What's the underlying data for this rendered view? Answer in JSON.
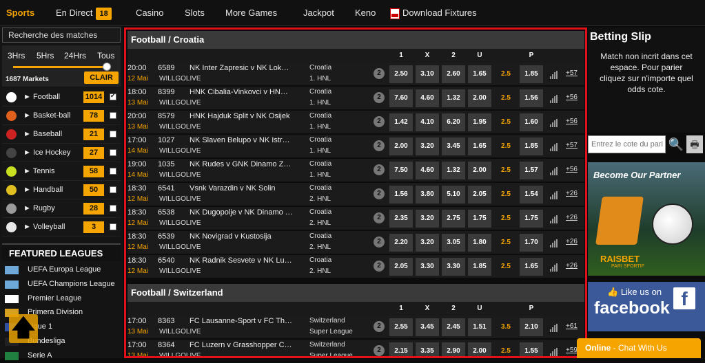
{
  "nav": {
    "sports": "Sports",
    "en_direct": "En Direct",
    "live_count": "18",
    "casino": "Casino",
    "slots": "Slots",
    "more_games": "More Games",
    "jackpot": "Jackpot",
    "keno": "Keno",
    "download": "Download Fixtures"
  },
  "sidebar": {
    "search": "Recherche des matches",
    "timeframes": [
      "3Hrs",
      "5Hrs",
      "24Hrs",
      "Tous"
    ],
    "markets": "1687 Markets",
    "clear": "CLAIR",
    "sports": [
      {
        "name": "► Football",
        "count": "1014",
        "checked": true,
        "color": "#ffffff"
      },
      {
        "name": "► Basket-ball",
        "count": "78",
        "checked": false,
        "color": "#e0601c"
      },
      {
        "name": "► Baseball",
        "count": "21",
        "checked": false,
        "color": "#cc2222"
      },
      {
        "name": "► Ice Hockey",
        "count": "27",
        "checked": false,
        "color": "#444444"
      },
      {
        "name": "► Tennis",
        "count": "58",
        "checked": false,
        "color": "#c8e020"
      },
      {
        "name": "► Handball",
        "count": "50",
        "checked": false,
        "color": "#e0c020"
      },
      {
        "name": "► Rugby",
        "count": "28",
        "checked": false,
        "color": "#9a9a9a"
      },
      {
        "name": "► Volleyball",
        "count": "3",
        "checked": false,
        "color": "#e8e8e8"
      }
    ],
    "featured_title": "FEATURED LEAGUES",
    "leagues": [
      {
        "name": "UEFA Europa League",
        "flag": "#6ea8d8"
      },
      {
        "name": "UEFA Champions League",
        "flag": "#6ea8d8"
      },
      {
        "name": "Premier League",
        "flag": "#ffffff"
      },
      {
        "name": "Primera Division",
        "flag": "#d8a020"
      },
      {
        "name": "Ligue 1",
        "flag": "#3050a0"
      },
      {
        "name": "Bundesliga",
        "flag": "#222222"
      },
      {
        "name": "Serie A",
        "flag": "#208040"
      }
    ]
  },
  "odds_columns": [
    "1",
    "X",
    "2",
    "U",
    "P"
  ],
  "sections": [
    {
      "title": "Football / Croatia",
      "matches": [
        {
          "time": "20:00",
          "date": "12 Mai",
          "code": "6589",
          "match": "NK Inter Zapresic v NK Lok…",
          "src": "WILLGOLIVE",
          "country": "Croatia",
          "comp": "1. HNL",
          "o1": "2.50",
          "ox": "3.10",
          "o2": "2.60",
          "ou": "1.65",
          "line": "2.5",
          "op": "1.85",
          "more": "+57"
        },
        {
          "time": "18:00",
          "date": "13 Mai",
          "code": "8399",
          "match": "HNK Cibalia-Vinkovci v HN…",
          "src": "WILLGOLIVE",
          "country": "Croatia",
          "comp": "1. HNL",
          "o1": "7.60",
          "ox": "4.60",
          "o2": "1.32",
          "ou": "2.00",
          "line": "2.5",
          "op": "1.56",
          "more": "+56"
        },
        {
          "time": "20:00",
          "date": "13 Mai",
          "code": "8579",
          "match": "HNK Hajduk Split v NK Osijek",
          "src": "WILLGOLIVE",
          "country": "Croatia",
          "comp": "1. HNL",
          "o1": "1.42",
          "ox": "4.10",
          "o2": "6.20",
          "ou": "1.95",
          "line": "2.5",
          "op": "1.60",
          "more": "+56"
        },
        {
          "time": "17:00",
          "date": "14 Mai",
          "code": "1027",
          "match": "NK Slaven Belupo v NK Istr…",
          "src": "WILLGOLIVE",
          "country": "Croatia",
          "comp": "1. HNL",
          "o1": "2.00",
          "ox": "3.20",
          "o2": "3.45",
          "ou": "1.65",
          "line": "2.5",
          "op": "1.85",
          "more": "+57"
        },
        {
          "time": "19:00",
          "date": "14 Mai",
          "code": "1035",
          "match": "NK Rudes v GNK Dinamo Z…",
          "src": "WILLGOLIVE",
          "country": "Croatia",
          "comp": "1. HNL",
          "o1": "7.50",
          "ox": "4.60",
          "o2": "1.32",
          "ou": "2.00",
          "line": "2.5",
          "op": "1.57",
          "more": "+56"
        },
        {
          "time": "18:30",
          "date": "12 Mai",
          "code": "6541",
          "match": "Vsnk Varazdin v NK Solin",
          "src": "WILLGOLIVE",
          "country": "Croatia",
          "comp": "2. HNL",
          "o1": "1.56",
          "ox": "3.80",
          "o2": "5.10",
          "ou": "2.05",
          "line": "2.5",
          "op": "1.54",
          "more": "+26"
        },
        {
          "time": "18:30",
          "date": "12 Mai",
          "code": "6538",
          "match": "NK Dugopolje v NK Dinamo …",
          "src": "WILLGOLIVE",
          "country": "Croatia",
          "comp": "2. HNL",
          "o1": "2.35",
          "ox": "3.20",
          "o2": "2.75",
          "ou": "1.75",
          "line": "2.5",
          "op": "1.75",
          "more": "+26"
        },
        {
          "time": "18:30",
          "date": "12 Mai",
          "code": "6539",
          "match": "NK Novigrad v Kustosija",
          "src": "WILLGOLIVE",
          "country": "Croatia",
          "comp": "2. HNL",
          "o1": "2.20",
          "ox": "3.20",
          "o2": "3.05",
          "ou": "1.80",
          "line": "2.5",
          "op": "1.70",
          "more": "+26"
        },
        {
          "time": "18:30",
          "date": "12 Mai",
          "code": "6540",
          "match": "NK Radnik Sesvete v NK Lu…",
          "src": "WILLGOLIVE",
          "country": "Croatia",
          "comp": "2. HNL",
          "o1": "2.05",
          "ox": "3.30",
          "o2": "3.30",
          "ou": "1.85",
          "line": "2.5",
          "op": "1.65",
          "more": "+26"
        }
      ]
    },
    {
      "title": "Football / Switzerland",
      "matches": [
        {
          "time": "17:00",
          "date": "13 Mai",
          "code": "8363",
          "match": "FC Lausanne-Sport v FC Th…",
          "src": "WILLGOLIVE",
          "country": "Switzerland",
          "comp": "Super League",
          "o1": "2.55",
          "ox": "3.45",
          "o2": "2.45",
          "ou": "1.51",
          "line": "3.5",
          "op": "2.10",
          "more": "+61"
        },
        {
          "time": "17:00",
          "date": "13 Mai",
          "code": "8364",
          "match": "FC Luzern v Grasshopper C…",
          "src": "WILLGOLIVE",
          "country": "Switzerland",
          "comp": "Super League",
          "o1": "2.15",
          "ox": "3.35",
          "o2": "2.90",
          "ou": "2.00",
          "line": "2.5",
          "op": "1.55",
          "more": "+59"
        }
      ]
    }
  ],
  "betslip": {
    "title": "Betting Slip",
    "message": "Match non incrit dans cet espace. Pour parier cliquez sur n'importe quel odds cote.",
    "odds_placeholder": "Entrez le cote du pari"
  },
  "partner": {
    "title": "Become Our Partner",
    "brand": "RAISBET",
    "brand_sub": "PARI SPORTIF"
  },
  "facebook": {
    "like": "Like us on",
    "name": "facebook"
  },
  "chat": {
    "online": "Online",
    "label": " - Chat With Us"
  },
  "accent": "#f6a400"
}
